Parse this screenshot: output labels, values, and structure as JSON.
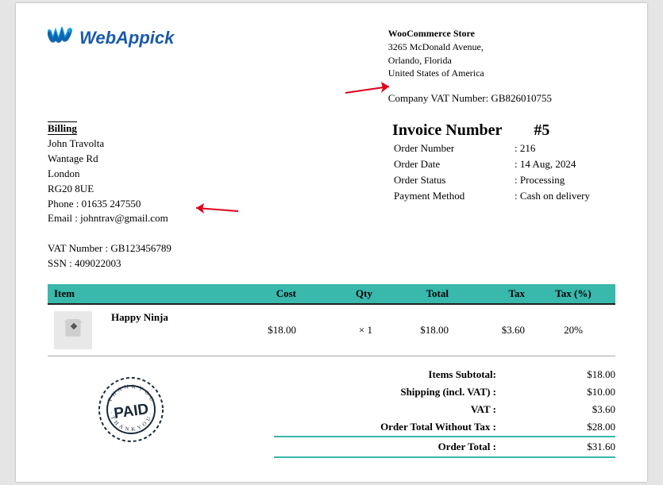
{
  "logo_text": "WebAppick",
  "store": {
    "name": "WooCommerce Store",
    "addr1": "3265 McDonald Avenue,",
    "addr2": "Orlando, Florida",
    "country": "United States of America",
    "vat": "Company VAT Number: GB826010755"
  },
  "billing": {
    "title": "Billing",
    "name": "John Travolta",
    "street": "Wantage Rd",
    "city": "London",
    "postcode": "RG20 8UE",
    "phone": "Phone : 01635 247550",
    "email": "Email : johntrav@gmail.com",
    "vat": "VAT Number : GB123456789",
    "ssn": "SSN : 409022003"
  },
  "invoice": {
    "title": "Invoice Number",
    "number": "#5",
    "order_number_label": "Order Number",
    "order_number": ": 216",
    "order_date_label": "Order Date",
    "order_date": ": 14 Aug, 2024",
    "order_status_label": "Order Status",
    "order_status": ": Processing",
    "payment_label": "Payment Method",
    "payment": ": Cash on delivery"
  },
  "headers": {
    "item": "Item",
    "cost": "Cost",
    "qty": "Qty",
    "total": "Total",
    "tax": "Tax",
    "taxpct": "Tax (%)"
  },
  "line": {
    "name": "Happy Ninja",
    "cost": "$18.00",
    "qty": "× 1",
    "total": "$18.00",
    "tax": "$3.60",
    "taxpct": "20%"
  },
  "totals": {
    "subtotal_label": "Items Subtotal:",
    "subtotal": "$18.00",
    "shipping_label": "Shipping (incl. VAT) :",
    "shipping": "$10.00",
    "vat_label": "VAT :",
    "vat": "$3.60",
    "without_tax_label": "Order Total Without Tax :",
    "without_tax": "$28.00",
    "grand_label": "Order Total :",
    "grand": "$31.60"
  },
  "stamp_text": "PAID"
}
